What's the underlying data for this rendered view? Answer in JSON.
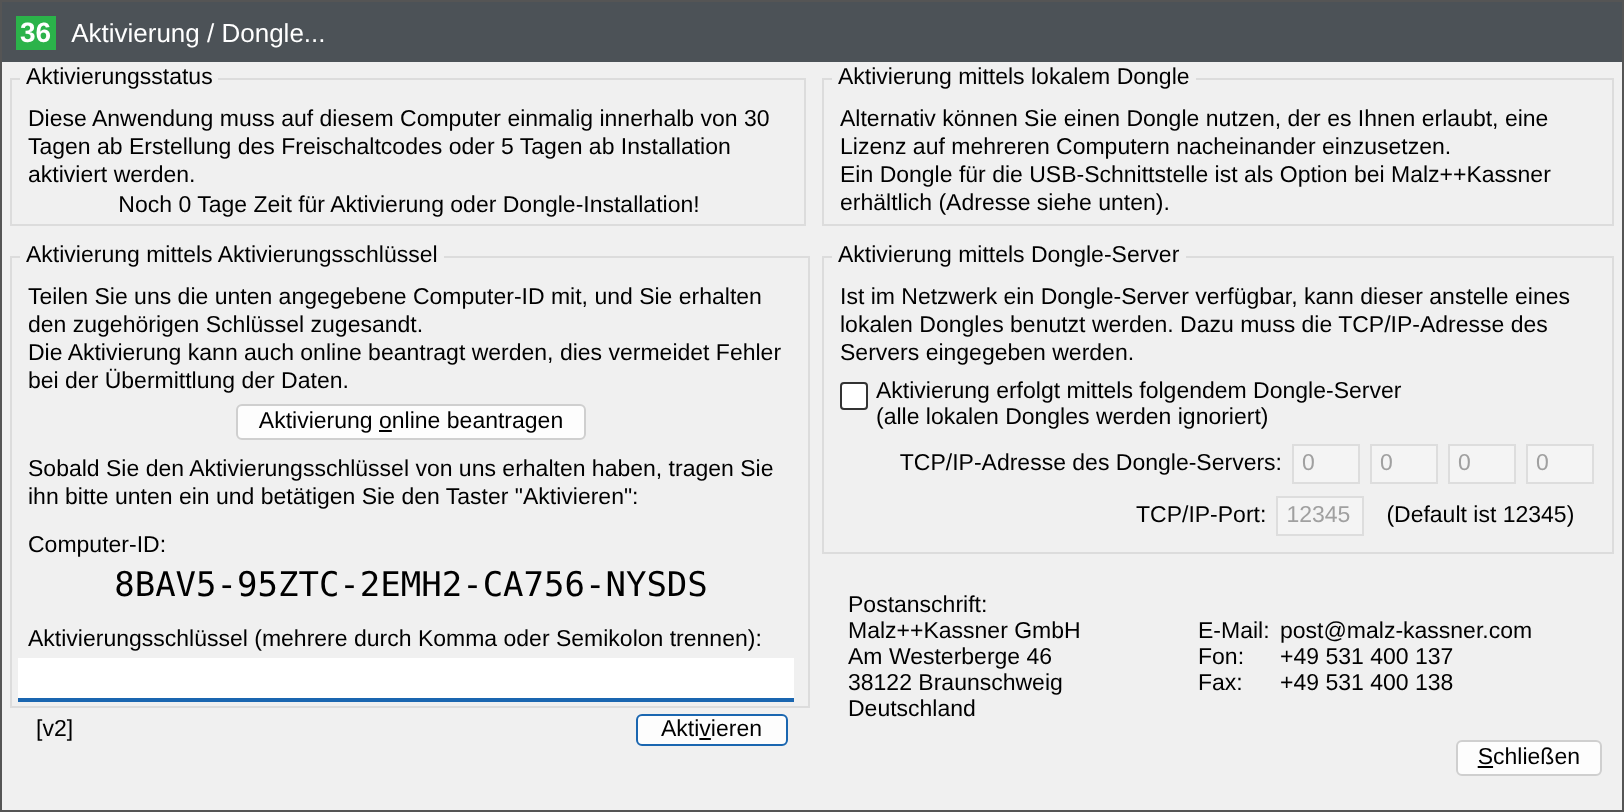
{
  "window": {
    "title": "Aktivierung / Dongle...",
    "icon_text": "36"
  },
  "status": {
    "heading": "Aktivierungsstatus",
    "text": "Diese Anwendung muss auf diesem Computer einmalig innerhalb von 30 Tagen ab Erstellung des Freischaltcodes oder 5 Tagen ab Installation aktiviert werden.",
    "remaining": "Noch 0 Tage Zeit für Aktivierung oder Dongle-Installation!"
  },
  "key_activation": {
    "heading": "Aktivierung mittels Aktivierungsschlüssel",
    "text1": "Teilen Sie uns die unten angegebene Computer-ID mit, und Sie erhalten den zugehörigen Schlüssel zugesandt.\nDie Aktivierung kann auch online beantragt werden, dies vermeidet Fehler bei der Übermittlung der Daten.",
    "online_button": [
      "Aktivierung ",
      "o",
      "nline beantragen"
    ],
    "text2": "Sobald Sie den Aktivierungsschlüssel von uns erhalten haben, tragen Sie ihn bitte unten ein und betätigen Sie den Taster \"Aktivieren\":",
    "id_label": "Computer-ID:",
    "computer_id": "8BAV5-95ZTC-2EMH2-CA756-NYSDS",
    "key_label": "Aktivierungsschlüssel (mehrere durch Komma oder Semikolon trennen):",
    "version": "[v2]",
    "activate_button": [
      "Akti",
      "v",
      "ieren"
    ]
  },
  "local_dongle": {
    "heading": "Aktivierung mittels lokalem Dongle",
    "text": "Alternativ können Sie einen Dongle nutzen, der es Ihnen erlaubt, eine Lizenz auf mehreren Computern nacheinander einzusetzen.\nEin Dongle für die USB-Schnittstelle ist als Option bei Malz++Kassner erhältlich (Adresse siehe unten)."
  },
  "dongle_server": {
    "heading": "Aktivierung mittels Dongle-Server",
    "text": "Ist im Netzwerk ein Dongle-Server verfügbar, kann dieser anstelle eines lokalen Dongles benutzt werden. Dazu muss die TCP/IP-Adresse des Servers eingegeben werden.",
    "checkbox": {
      "label": "Aktivierung erfolgt mittels folgendem Dongle-Server\n(alle lokalen Dongles werden ignoriert)",
      "checked": false
    },
    "address_label": "TCP/IP-Adresse des Dongle-Servers:",
    "address": [
      "0",
      "0",
      "0",
      "0"
    ],
    "port_label": "TCP/IP-Port:",
    "port": "12345",
    "port_hint": "(Default ist 12345)"
  },
  "address": {
    "postal": "Postanschrift:\nMalz++Kassner GmbH\nAm Westerberge 46\n38122 Braunschweig\nDeutschland",
    "contacts": [
      {
        "label": "E-Mail:",
        "value": "post@malz-kassner.com"
      },
      {
        "label": "Fon:",
        "value": "+49 531 400 137"
      },
      {
        "label": "Fax:",
        "value": "+49 531 400 138"
      }
    ]
  },
  "close_button": [
    "S",
    "chließen"
  ]
}
